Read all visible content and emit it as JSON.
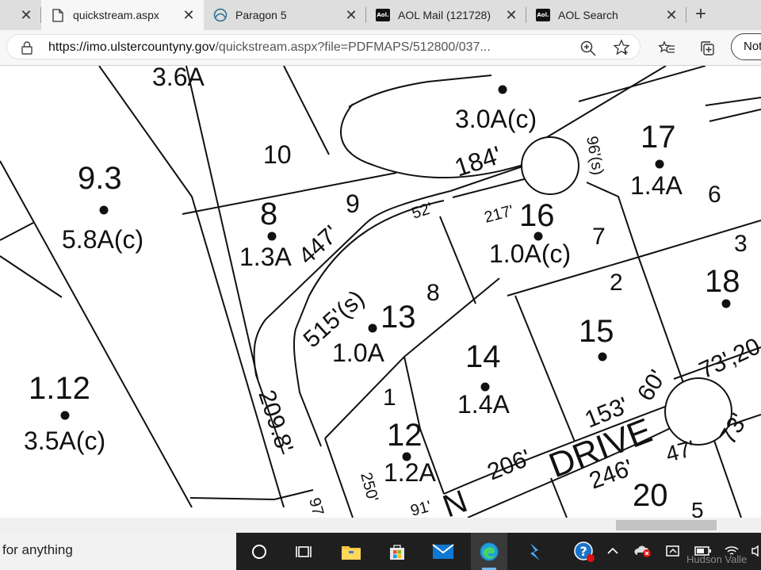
{
  "tabs": [
    {
      "title": "",
      "active": false,
      "icon": "close-icon"
    },
    {
      "title": "quickstream.aspx",
      "active": true,
      "icon": "page-icon"
    },
    {
      "title": "Paragon 5",
      "active": false,
      "icon": "paragon-icon"
    },
    {
      "title": "AOL Mail (121728)",
      "active": false,
      "icon": "aol-icon"
    },
    {
      "title": "AOL Search",
      "active": false,
      "icon": "aol-icon"
    }
  ],
  "aol_logo_text": "Aol.",
  "address_bar": {
    "url_host": "https://imo.ulstercountyny.gov",
    "url_rest": "/quickstream.aspx?file=PDFMAPS/512800/037..."
  },
  "profile_button": "Not",
  "map": {
    "labels": [
      {
        "text": "3.6A",
        "kind": "area"
      },
      {
        "text": "10",
        "kind": "plot"
      },
      {
        "text": "9.3",
        "kind": "lot"
      },
      {
        "text": "5.8A(c)",
        "kind": "area"
      },
      {
        "text": "8",
        "kind": "lot"
      },
      {
        "text": "1.3A",
        "kind": "area"
      },
      {
        "text": "9",
        "kind": "plot"
      },
      {
        "text": "447'",
        "kind": "dim"
      },
      {
        "text": "3.0A(c)",
        "kind": "area"
      },
      {
        "text": "184'",
        "kind": "dim"
      },
      {
        "text": "52'",
        "kind": "dim"
      },
      {
        "text": "96'(s)",
        "kind": "dim"
      },
      {
        "text": "17",
        "kind": "lot"
      },
      {
        "text": "1.4A",
        "kind": "area"
      },
      {
        "text": "6",
        "kind": "plot"
      },
      {
        "text": "217'",
        "kind": "dim"
      },
      {
        "text": "16",
        "kind": "lot"
      },
      {
        "text": "1.0A(c)",
        "kind": "area"
      },
      {
        "text": "7",
        "kind": "plot"
      },
      {
        "text": "3",
        "kind": "plot"
      },
      {
        "text": "18",
        "kind": "lot"
      },
      {
        "text": "2",
        "kind": "plot"
      },
      {
        "text": "515'(s)",
        "kind": "dim"
      },
      {
        "text": "13",
        "kind": "lot"
      },
      {
        "text": "1.0A",
        "kind": "area"
      },
      {
        "text": "8",
        "kind": "plot"
      },
      {
        "text": "15",
        "kind": "lot"
      },
      {
        "text": "14",
        "kind": "lot"
      },
      {
        "text": "1.4A",
        "kind": "area"
      },
      {
        "text": "1.12",
        "kind": "lot"
      },
      {
        "text": "3.5A(c)",
        "kind": "area"
      },
      {
        "text": "209.8'",
        "kind": "dim"
      },
      {
        "text": "1",
        "kind": "plot"
      },
      {
        "text": "12",
        "kind": "lot"
      },
      {
        "text": "1.2A",
        "kind": "area"
      },
      {
        "text": "153'",
        "kind": "dim"
      },
      {
        "text": "60'",
        "kind": "dim"
      },
      {
        "text": "73',20",
        "kind": "dim"
      },
      {
        "text": "DRIVE",
        "kind": "street"
      },
      {
        "text": "206'",
        "kind": "dim"
      },
      {
        "text": "73'",
        "kind": "dim"
      },
      {
        "text": "47'",
        "kind": "dim"
      },
      {
        "text": "246'",
        "kind": "dim"
      },
      {
        "text": "20",
        "kind": "lot"
      },
      {
        "text": "250'",
        "kind": "dim"
      },
      {
        "text": "97",
        "kind": "dim"
      },
      {
        "text": "91'",
        "kind": "dim"
      },
      {
        "text": "N",
        "kind": "street"
      },
      {
        "text": "5",
        "kind": "plot"
      }
    ]
  },
  "taskbar": {
    "search_text": "for anything",
    "overlay_text": "Hudson Valle"
  }
}
